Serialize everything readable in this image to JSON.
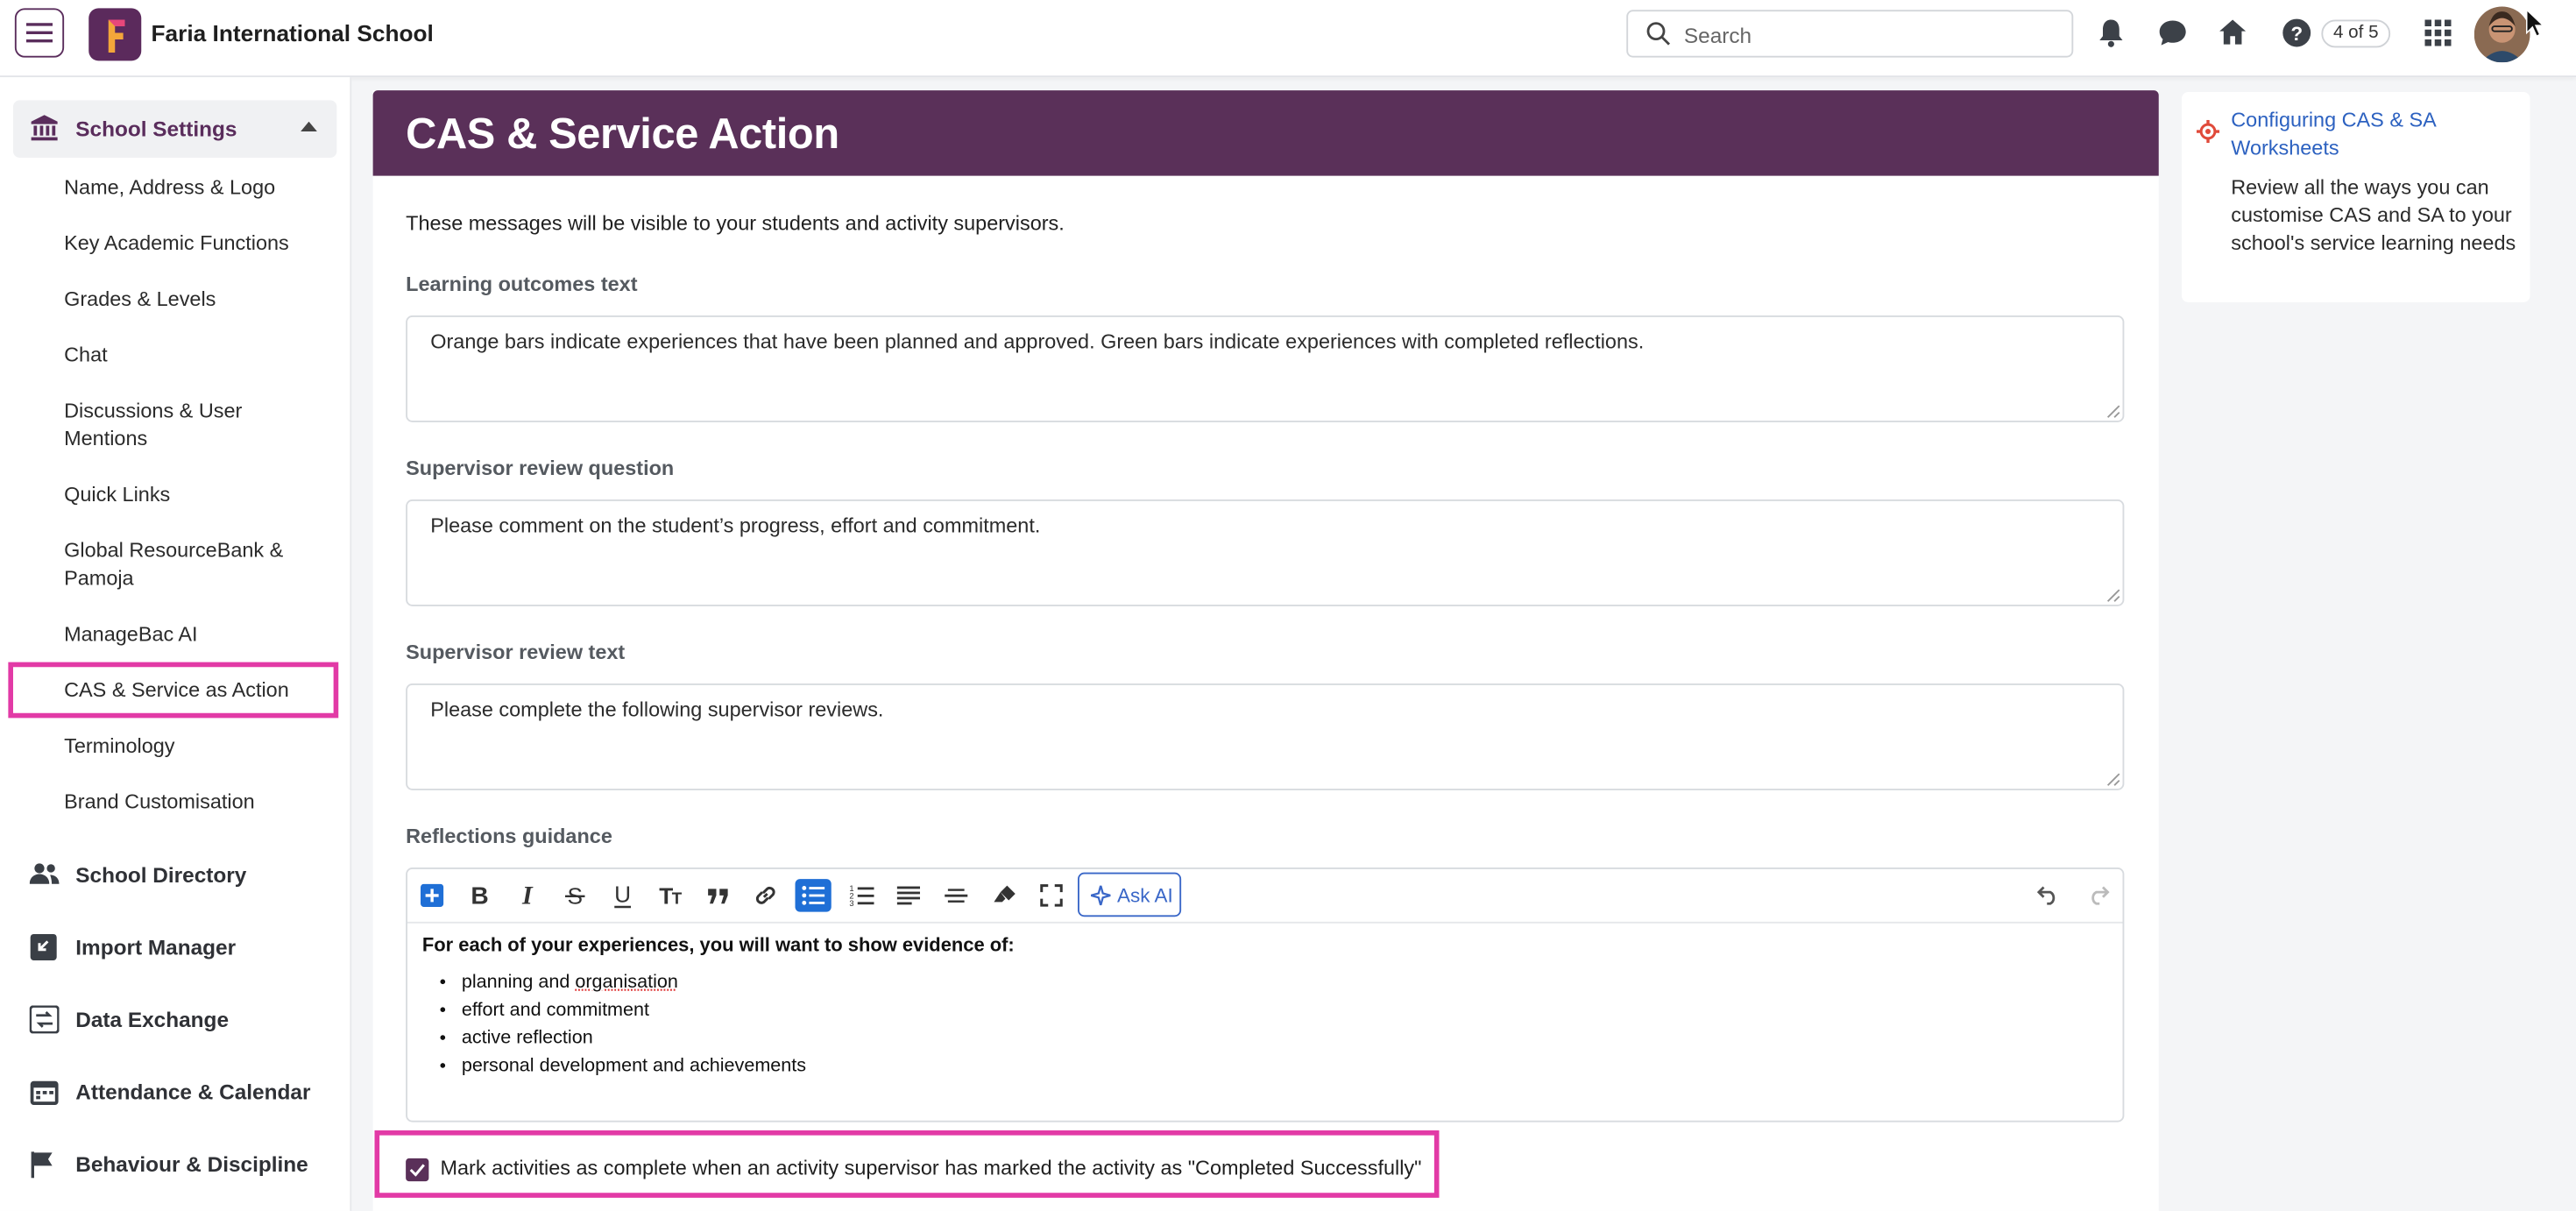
{
  "topbar": {
    "school_name": "Faria International School",
    "search_placeholder": "Search",
    "page_counter": "4 of 5",
    "icons": [
      "menu-icon",
      "bell-icon",
      "chat-icon",
      "home-icon",
      "help-icon",
      "apps-grid-icon"
    ]
  },
  "sidebar": {
    "section_title": "School Settings",
    "items": [
      {
        "label": "Name, Address & Logo"
      },
      {
        "label": "Key Academic Functions"
      },
      {
        "label": "Grades & Levels"
      },
      {
        "label": "Chat"
      },
      {
        "label": "Discussions & User Mentions"
      },
      {
        "label": "Quick Links"
      },
      {
        "label": "Global ResourceBank & Pamoja"
      },
      {
        "label": "ManageBac AI"
      },
      {
        "label": "CAS & Service as Action"
      },
      {
        "label": "Terminology"
      },
      {
        "label": "Brand Customisation"
      }
    ],
    "main_items": [
      {
        "label": "School Directory"
      },
      {
        "label": "Import Manager"
      },
      {
        "label": "Data Exchange"
      },
      {
        "label": "Attendance & Calendar"
      },
      {
        "label": "Behaviour & Discipline"
      }
    ]
  },
  "main": {
    "title": "CAS & Service Action",
    "intro": "These messages will be visible to your students and activity supervisors.",
    "fields": [
      {
        "label": "Learning outcomes text",
        "value": "Orange bars indicate experiences that have been planned and approved. Green bars indicate experiences with completed reflections."
      },
      {
        "label": "Supervisor review question",
        "value": "Please comment on the student’s progress, effort and commitment."
      },
      {
        "label": "Supervisor review text",
        "value": "Please complete the following supervisor reviews."
      }
    ],
    "reflections": {
      "label": "Reflections guidance",
      "ask_ai_label": "Ask AI",
      "heading": "For each of your experiences, you will want to show evidence of:",
      "bullets": [
        {
          "pre": "planning and ",
          "squiggle": "organisation"
        },
        {
          "pre": "effort and commitment"
        },
        {
          "pre": "active reflection"
        },
        {
          "pre": "personal development and achievements"
        }
      ]
    },
    "checkbox_label": "Mark activities as complete when an activity supervisor has marked the activity as \"Completed Successfully\"",
    "checkbox_checked": true
  },
  "help": {
    "link": "Configuring CAS & SA Worksheets",
    "description": "Review all the ways you can customise CAS and SA to your school's service learning needs"
  },
  "colors": {
    "brand": "#5a3059",
    "highlight": "#e23aa6",
    "link": "#2c61c0",
    "toolbar_active": "#1f6fd6"
  }
}
